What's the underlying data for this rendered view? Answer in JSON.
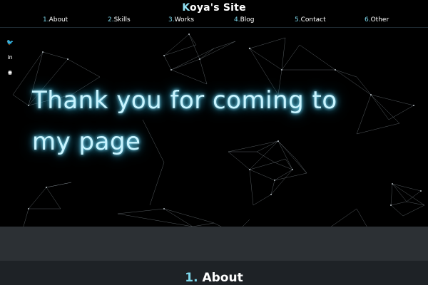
{
  "header": {
    "title_first": "K",
    "title_rest": "oya's Site"
  },
  "nav": [
    {
      "num": "1.",
      "label": "About"
    },
    {
      "num": "2.",
      "label": "Skills"
    },
    {
      "num": "3.",
      "label": "Works"
    },
    {
      "num": "4.",
      "label": "Blog"
    },
    {
      "num": "5.",
      "label": "Contact"
    },
    {
      "num": "6.",
      "label": "Other"
    }
  ],
  "social": [
    {
      "icon": "twitter-icon",
      "glyph": "🐦"
    },
    {
      "icon": "linkedin-icon",
      "glyph": "in"
    },
    {
      "icon": "github-icon",
      "glyph": "◉"
    }
  ],
  "hero": {
    "line1": "Thank you for coming to",
    "line2": "my page"
  },
  "about": {
    "num": "1.",
    "title": "About"
  },
  "colors": {
    "accent": "#7dd7ea",
    "glow": "#3fb5d8",
    "background": "#000000",
    "band": "#2c3034"
  }
}
